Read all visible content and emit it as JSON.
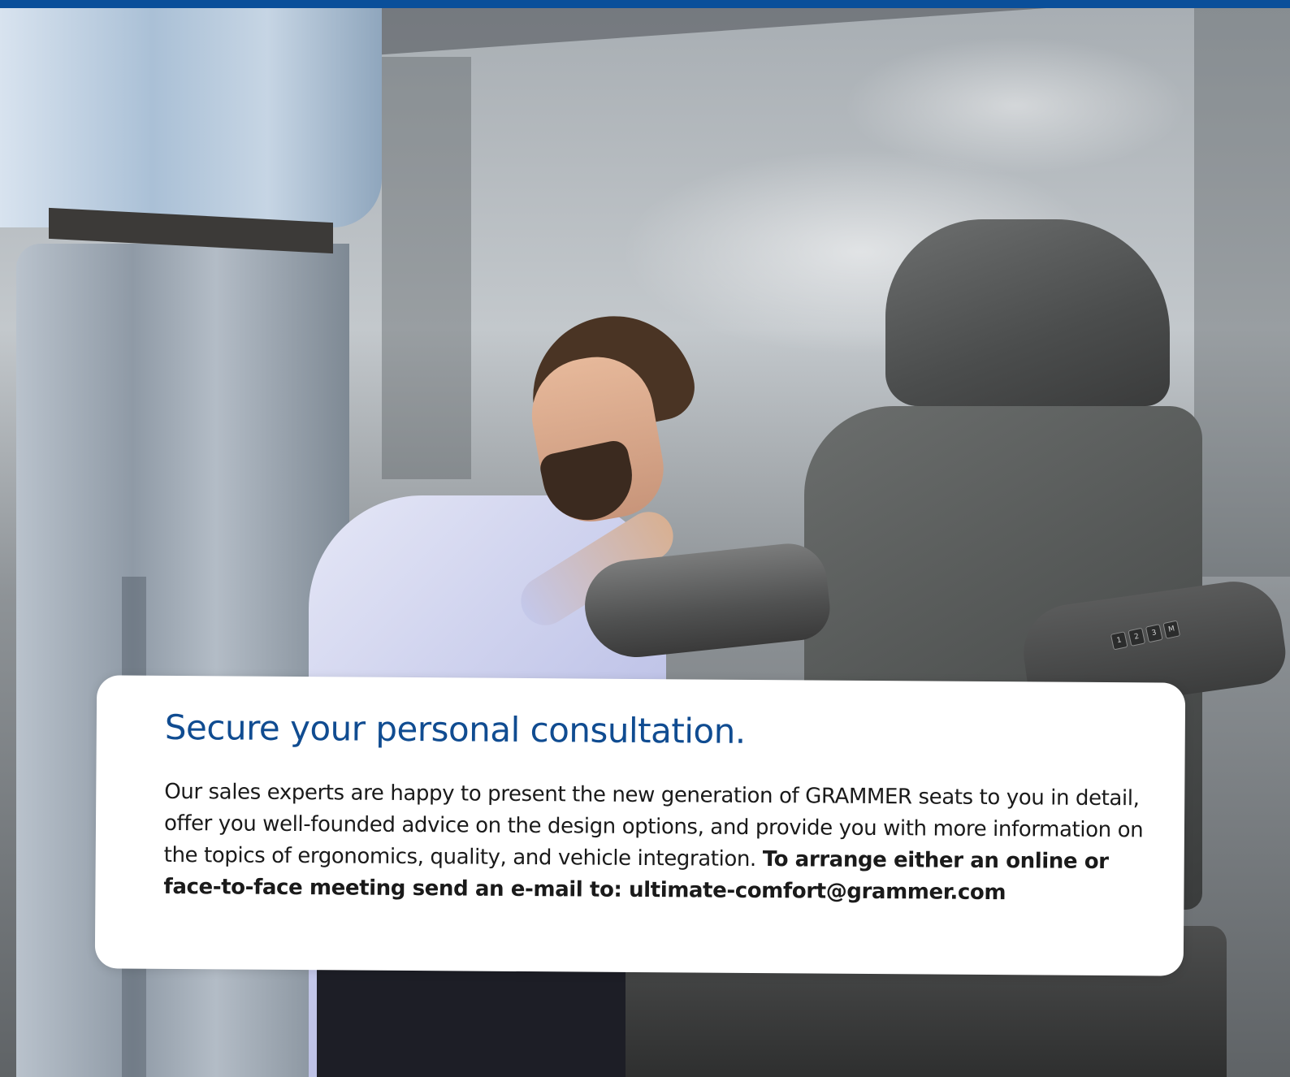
{
  "colors": {
    "brand_blue": "#0a4f9a",
    "title_blue": "#104c91",
    "card_background": "#ffffff",
    "body_text": "#1a1a1a"
  },
  "photo": {
    "seat_armrest_buttons": [
      "1",
      "2",
      "3",
      "M"
    ]
  },
  "consultation": {
    "title": "Secure your personal consultation.",
    "body_regular": "Our sales experts are happy to present the new generation of GRAMMER seats to you in detail, offer you well-founded advice on the design options, and provide you with more information on the topics of ergonomics, quality, and vehicle integration.",
    "body_bold": "To arrange either an online or face-to-face meeting send an e-mail to: ultimate-comfort@grammer.com"
  }
}
